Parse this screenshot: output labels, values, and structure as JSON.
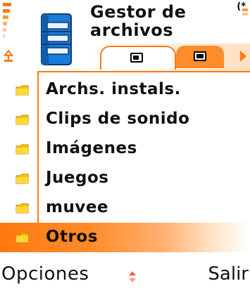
{
  "header": {
    "title": "Gestor de archivos",
    "bt_indicator": "(*"
  },
  "tabs": [
    {
      "icon": "phone-memory-icon",
      "active": true
    },
    {
      "icon": "memory-card-icon",
      "active": false
    }
  ],
  "file_list": {
    "items": [
      {
        "label": "Archs. instals.",
        "icon": "folder-icon"
      },
      {
        "label": "Clips de sonido",
        "icon": "folder-icon"
      },
      {
        "label": "Imágenes",
        "icon": "folder-icon"
      },
      {
        "label": "Juegos",
        "icon": "folder-icon"
      },
      {
        "label": "muvee",
        "icon": "folder-icon"
      },
      {
        "label": "Otros",
        "icon": "folder-icon",
        "selected": true
      }
    ]
  },
  "softkeys": {
    "left": "Opciones",
    "right": "Salir"
  },
  "colors": {
    "accent": "#ff7a10",
    "icon_blue": "#1a7bd8",
    "folder": "#f8c400"
  }
}
